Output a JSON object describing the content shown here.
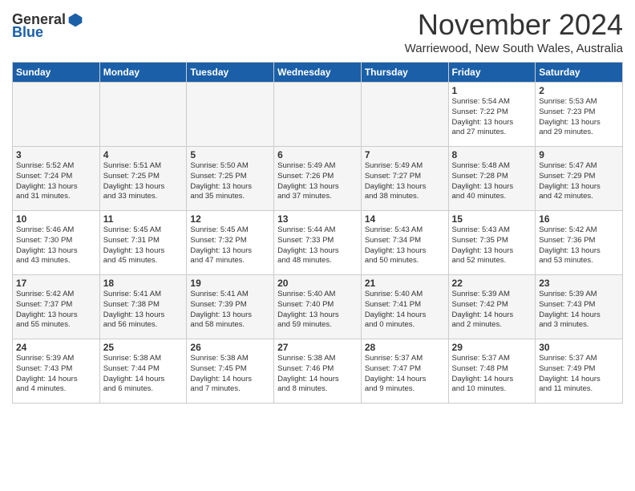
{
  "header": {
    "logo_general": "General",
    "logo_blue": "Blue",
    "month_title": "November 2024",
    "location": "Warriewood, New South Wales, Australia"
  },
  "days_of_week": [
    "Sunday",
    "Monday",
    "Tuesday",
    "Wednesday",
    "Thursday",
    "Friday",
    "Saturday"
  ],
  "weeks": [
    [
      {
        "day": "",
        "info": ""
      },
      {
        "day": "",
        "info": ""
      },
      {
        "day": "",
        "info": ""
      },
      {
        "day": "",
        "info": ""
      },
      {
        "day": "",
        "info": ""
      },
      {
        "day": "1",
        "info": "Sunrise: 5:54 AM\nSunset: 7:22 PM\nDaylight: 13 hours\nand 27 minutes."
      },
      {
        "day": "2",
        "info": "Sunrise: 5:53 AM\nSunset: 7:23 PM\nDaylight: 13 hours\nand 29 minutes."
      }
    ],
    [
      {
        "day": "3",
        "info": "Sunrise: 5:52 AM\nSunset: 7:24 PM\nDaylight: 13 hours\nand 31 minutes."
      },
      {
        "day": "4",
        "info": "Sunrise: 5:51 AM\nSunset: 7:25 PM\nDaylight: 13 hours\nand 33 minutes."
      },
      {
        "day": "5",
        "info": "Sunrise: 5:50 AM\nSunset: 7:25 PM\nDaylight: 13 hours\nand 35 minutes."
      },
      {
        "day": "6",
        "info": "Sunrise: 5:49 AM\nSunset: 7:26 PM\nDaylight: 13 hours\nand 37 minutes."
      },
      {
        "day": "7",
        "info": "Sunrise: 5:49 AM\nSunset: 7:27 PM\nDaylight: 13 hours\nand 38 minutes."
      },
      {
        "day": "8",
        "info": "Sunrise: 5:48 AM\nSunset: 7:28 PM\nDaylight: 13 hours\nand 40 minutes."
      },
      {
        "day": "9",
        "info": "Sunrise: 5:47 AM\nSunset: 7:29 PM\nDaylight: 13 hours\nand 42 minutes."
      }
    ],
    [
      {
        "day": "10",
        "info": "Sunrise: 5:46 AM\nSunset: 7:30 PM\nDaylight: 13 hours\nand 43 minutes."
      },
      {
        "day": "11",
        "info": "Sunrise: 5:45 AM\nSunset: 7:31 PM\nDaylight: 13 hours\nand 45 minutes."
      },
      {
        "day": "12",
        "info": "Sunrise: 5:45 AM\nSunset: 7:32 PM\nDaylight: 13 hours\nand 47 minutes."
      },
      {
        "day": "13",
        "info": "Sunrise: 5:44 AM\nSunset: 7:33 PM\nDaylight: 13 hours\nand 48 minutes."
      },
      {
        "day": "14",
        "info": "Sunrise: 5:43 AM\nSunset: 7:34 PM\nDaylight: 13 hours\nand 50 minutes."
      },
      {
        "day": "15",
        "info": "Sunrise: 5:43 AM\nSunset: 7:35 PM\nDaylight: 13 hours\nand 52 minutes."
      },
      {
        "day": "16",
        "info": "Sunrise: 5:42 AM\nSunset: 7:36 PM\nDaylight: 13 hours\nand 53 minutes."
      }
    ],
    [
      {
        "day": "17",
        "info": "Sunrise: 5:42 AM\nSunset: 7:37 PM\nDaylight: 13 hours\nand 55 minutes."
      },
      {
        "day": "18",
        "info": "Sunrise: 5:41 AM\nSunset: 7:38 PM\nDaylight: 13 hours\nand 56 minutes."
      },
      {
        "day": "19",
        "info": "Sunrise: 5:41 AM\nSunset: 7:39 PM\nDaylight: 13 hours\nand 58 minutes."
      },
      {
        "day": "20",
        "info": "Sunrise: 5:40 AM\nSunset: 7:40 PM\nDaylight: 13 hours\nand 59 minutes."
      },
      {
        "day": "21",
        "info": "Sunrise: 5:40 AM\nSunset: 7:41 PM\nDaylight: 14 hours\nand 0 minutes."
      },
      {
        "day": "22",
        "info": "Sunrise: 5:39 AM\nSunset: 7:42 PM\nDaylight: 14 hours\nand 2 minutes."
      },
      {
        "day": "23",
        "info": "Sunrise: 5:39 AM\nSunset: 7:43 PM\nDaylight: 14 hours\nand 3 minutes."
      }
    ],
    [
      {
        "day": "24",
        "info": "Sunrise: 5:39 AM\nSunset: 7:43 PM\nDaylight: 14 hours\nand 4 minutes."
      },
      {
        "day": "25",
        "info": "Sunrise: 5:38 AM\nSunset: 7:44 PM\nDaylight: 14 hours\nand 6 minutes."
      },
      {
        "day": "26",
        "info": "Sunrise: 5:38 AM\nSunset: 7:45 PM\nDaylight: 14 hours\nand 7 minutes."
      },
      {
        "day": "27",
        "info": "Sunrise: 5:38 AM\nSunset: 7:46 PM\nDaylight: 14 hours\nand 8 minutes."
      },
      {
        "day": "28",
        "info": "Sunrise: 5:37 AM\nSunset: 7:47 PM\nDaylight: 14 hours\nand 9 minutes."
      },
      {
        "day": "29",
        "info": "Sunrise: 5:37 AM\nSunset: 7:48 PM\nDaylight: 14 hours\nand 10 minutes."
      },
      {
        "day": "30",
        "info": "Sunrise: 5:37 AM\nSunset: 7:49 PM\nDaylight: 14 hours\nand 11 minutes."
      }
    ]
  ]
}
